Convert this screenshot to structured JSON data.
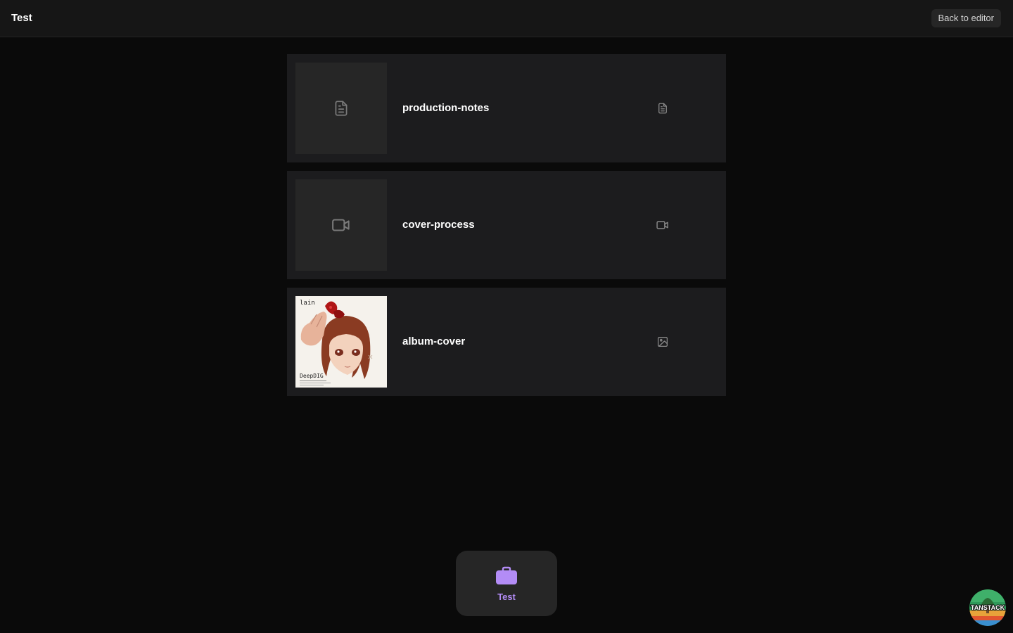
{
  "header": {
    "title": "Test",
    "back_label": "Back to editor"
  },
  "items": [
    {
      "name": "production-notes",
      "type_icon": "document-icon",
      "thumb": "document-placeholder"
    },
    {
      "name": "cover-process",
      "type_icon": "video-icon",
      "thumb": "video-placeholder"
    },
    {
      "name": "album-cover",
      "type_icon": "image-icon",
      "thumb": "cover-art",
      "thumb_text_top": "lain",
      "thumb_text_bottom": "DeepDIG"
    }
  ],
  "dock": {
    "label": "Test",
    "icon": "briefcase-icon",
    "accent": "#b38cf6"
  },
  "badge": {
    "label": "TANSTACK"
  },
  "colors": {
    "background": "#0a0a0a",
    "card": "#1c1c1e",
    "thumb": "#262626",
    "icon_gray": "#8a8a8a"
  }
}
